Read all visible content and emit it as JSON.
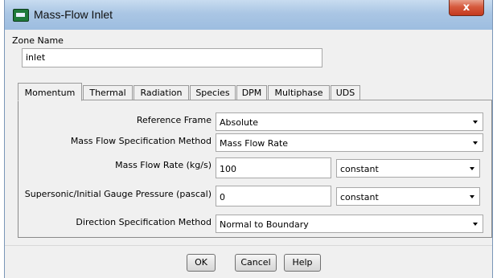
{
  "window": {
    "title": "Mass-Flow Inlet",
    "close_glyph": "x"
  },
  "zone": {
    "label": "Zone Name",
    "value": "inlet"
  },
  "tabs": [
    {
      "label": "Momentum",
      "active": true
    },
    {
      "label": "Thermal",
      "active": false
    },
    {
      "label": "Radiation",
      "active": false
    },
    {
      "label": "Species",
      "active": false
    },
    {
      "label": "DPM",
      "active": false
    },
    {
      "label": "Multiphase",
      "active": false
    },
    {
      "label": "UDS",
      "active": false
    }
  ],
  "momentum": {
    "reference_frame": {
      "label": "Reference Frame",
      "value": "Absolute"
    },
    "mass_flow_spec": {
      "label": "Mass Flow Specification Method",
      "value": "Mass Flow Rate"
    },
    "mass_flow_rate": {
      "label": "Mass Flow Rate (kg/s)",
      "value": "100",
      "profile": "constant"
    },
    "gauge_pressure": {
      "label": "Supersonic/Initial Gauge Pressure (pascal)",
      "value": "0",
      "profile": "constant"
    },
    "direction_spec": {
      "label": "Direction Specification Method",
      "value": "Normal to Boundary"
    }
  },
  "buttons": {
    "ok": "OK",
    "cancel": "Cancel",
    "help": "Help"
  },
  "colors": {
    "title_bar": "#aac6e4",
    "close_button": "#c4391e",
    "dialog_bg": "#f0f0f0"
  }
}
